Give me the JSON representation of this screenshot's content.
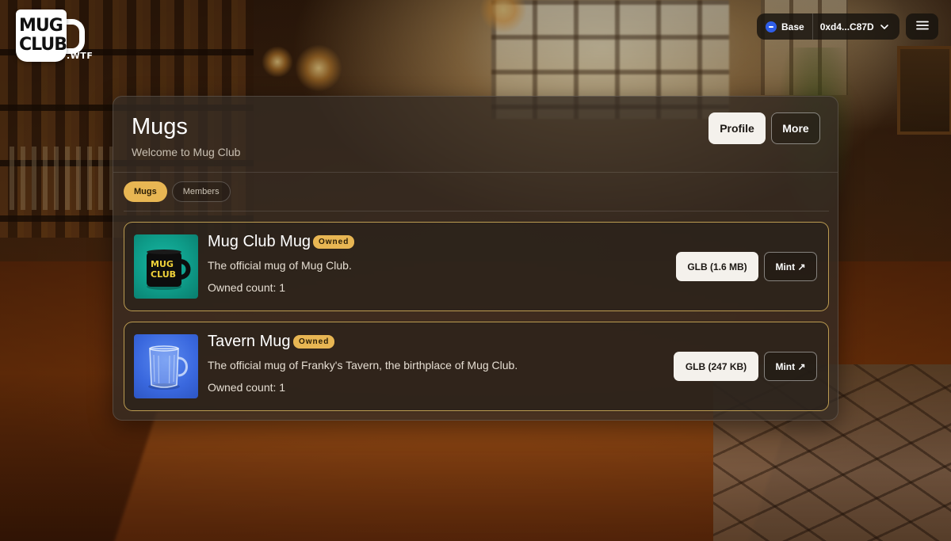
{
  "header": {
    "logo": {
      "line1": "MUG",
      "line2": "CLUB",
      "tld": ".WTF"
    },
    "network": {
      "name": "Base",
      "address": "0xd4...C87D",
      "icon": "base-network-icon",
      "color": "#2f5ee8"
    },
    "menu_icon": "hamburger-menu-icon"
  },
  "panel": {
    "title": "Mugs",
    "subtitle": "Welcome to Mug Club",
    "buttons": {
      "profile": "Profile",
      "more": "More"
    },
    "tabs": [
      {
        "label": "Mugs",
        "active": true
      },
      {
        "label": "Members",
        "active": false
      }
    ]
  },
  "mugs": [
    {
      "name": "Mug Club Mug",
      "badge": "Owned",
      "description": "The official mug of Mug Club.",
      "owned_count": "Owned count: 1",
      "glb_label": "GLB (1.6 MB)",
      "mint_label": "Mint ↗",
      "thumbnail": "black-mug-on-teal",
      "thumb_mug_text_1": "MUG",
      "thumb_mug_text_2": "CLUB"
    },
    {
      "name": "Tavern Mug",
      "badge": "Owned",
      "description": "The official mug of Franky's Tavern, the birthplace of Mug Club.",
      "owned_count": "Owned count: 1",
      "glb_label": "GLB (247 KB)",
      "mint_label": "Mint ↗",
      "thumbnail": "glass-mug-on-blue"
    }
  ],
  "colors": {
    "accent": "#e8b653",
    "card_border": "#d6b25c",
    "panel_bg": "#342c24"
  }
}
